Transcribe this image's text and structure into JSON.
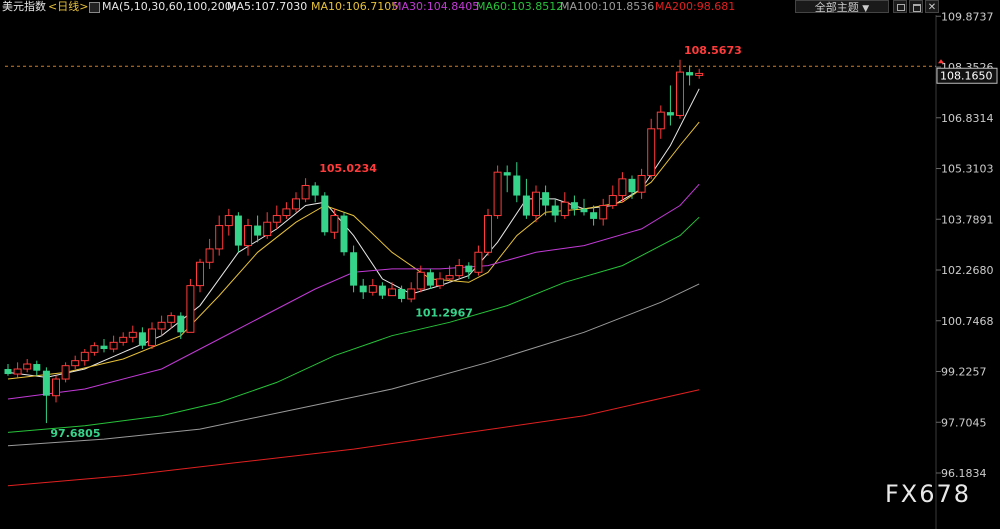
{
  "header": {
    "symbol": "美元指数",
    "period": "<日线>",
    "ma_label": "MA(5,10,30,60,100,200)",
    "ma5": "MA5:107.7030",
    "ma10": "MA10:106.7105",
    "ma30": "MA30:104.8405",
    "ma60": "MA60:103.8512",
    "ma100": "MA100:101.8536",
    "ma200": "MA200:98.681",
    "theme_label": "全部主题",
    "theme_arrow": "▼"
  },
  "watermark": "FX678",
  "colors": {
    "background": "#000000",
    "up": "#ff3b3b",
    "down": "#36d48a",
    "ma5": "#e8e8e8",
    "ma10": "#e6c13a",
    "ma30": "#c23ad6",
    "ma60": "#27c23a",
    "ma100": "#9a9a9a",
    "ma200": "#e02020",
    "axis_text": "#cccccc",
    "price_line": "#d07c2a"
  },
  "chart_data": {
    "type": "candlestick",
    "title": "美元指数",
    "period": "日线",
    "y_ticks": [
      109.8737,
      108.3526,
      106.8314,
      105.3103,
      103.7891,
      102.268,
      100.7468,
      99.2257,
      97.7045,
      96.1834
    ],
    "ylim": [
      95.8,
      110.3
    ],
    "current_price": "108.1650",
    "annotations": [
      {
        "label": "108.5673",
        "value": 108.5673,
        "bar": 70,
        "color": "#ff3b3b"
      },
      {
        "label": "105.0234",
        "value": 105.0234,
        "bar": 32,
        "color": "#ff3b3b"
      },
      {
        "label": "101.2967",
        "value": 101.2967,
        "bar": 42,
        "color": "#36d48a"
      },
      {
        "label": "97.6805",
        "value": 97.6805,
        "bar": 4,
        "color": "#36d48a"
      }
    ],
    "candles": [
      [
        99.3,
        99.15,
        99.45,
        99.1
      ],
      [
        99.15,
        99.3,
        99.5,
        99.05
      ],
      [
        99.3,
        99.45,
        99.6,
        99.2
      ],
      [
        99.45,
        99.25,
        99.55,
        99.1
      ],
      [
        99.25,
        98.5,
        99.35,
        97.68
      ],
      [
        98.5,
        99.0,
        99.1,
        98.3
      ],
      [
        99.0,
        99.4,
        99.5,
        98.9
      ],
      [
        99.4,
        99.55,
        99.7,
        99.3
      ],
      [
        99.55,
        99.8,
        99.9,
        99.4
      ],
      [
        99.8,
        100.0,
        100.1,
        99.7
      ],
      [
        100.0,
        99.9,
        100.2,
        99.8
      ],
      [
        99.9,
        100.1,
        100.3,
        99.8
      ],
      [
        100.1,
        100.25,
        100.4,
        100.0
      ],
      [
        100.25,
        100.4,
        100.6,
        100.1
      ],
      [
        100.4,
        100.0,
        100.55,
        99.9
      ],
      [
        100.0,
        100.5,
        100.7,
        99.9
      ],
      [
        100.5,
        100.7,
        100.9,
        100.3
      ],
      [
        100.7,
        100.9,
        101.0,
        100.5
      ],
      [
        100.9,
        100.4,
        101.0,
        100.2
      ],
      [
        100.4,
        101.8,
        102.0,
        100.4
      ],
      [
        101.8,
        102.5,
        102.6,
        101.6
      ],
      [
        102.5,
        102.9,
        103.2,
        102.3
      ],
      [
        102.9,
        103.6,
        103.9,
        102.7
      ],
      [
        103.6,
        103.9,
        104.1,
        103.3
      ],
      [
        103.9,
        103.0,
        104.0,
        102.8
      ],
      [
        103.0,
        103.6,
        103.8,
        102.7
      ],
      [
        103.6,
        103.3,
        103.9,
        103.1
      ],
      [
        103.3,
        103.7,
        104.0,
        103.2
      ],
      [
        103.7,
        103.9,
        104.2,
        103.5
      ],
      [
        103.9,
        104.1,
        104.3,
        103.8
      ],
      [
        104.1,
        104.4,
        104.6,
        104.0
      ],
      [
        104.4,
        104.8,
        105.02,
        104.3
      ],
      [
        104.8,
        104.5,
        104.9,
        104.3
      ],
      [
        104.5,
        103.4,
        104.6,
        103.3
      ],
      [
        103.4,
        103.9,
        104.1,
        103.2
      ],
      [
        103.9,
        102.8,
        104.0,
        102.7
      ],
      [
        102.8,
        101.8,
        103.0,
        101.6
      ],
      [
        101.8,
        101.6,
        102.0,
        101.4
      ],
      [
        101.6,
        101.8,
        102.0,
        101.5
      ],
      [
        101.8,
        101.5,
        101.9,
        101.4
      ],
      [
        101.5,
        101.7,
        101.9,
        101.5
      ],
      [
        101.7,
        101.4,
        101.8,
        101.3
      ],
      [
        101.4,
        101.7,
        101.9,
        101.3
      ],
      [
        101.7,
        102.2,
        102.4,
        101.6
      ],
      [
        102.2,
        101.8,
        102.3,
        101.7
      ],
      [
        101.8,
        102.0,
        102.2,
        101.7
      ],
      [
        102.0,
        102.1,
        102.4,
        101.9
      ],
      [
        102.1,
        102.4,
        102.6,
        102.0
      ],
      [
        102.4,
        102.2,
        102.5,
        102.0
      ],
      [
        102.2,
        102.8,
        103.0,
        102.1
      ],
      [
        102.8,
        103.9,
        104.1,
        102.7
      ],
      [
        103.9,
        105.2,
        105.4,
        103.8
      ],
      [
        105.2,
        105.1,
        105.4,
        104.6
      ],
      [
        105.1,
        104.5,
        105.5,
        104.3
      ],
      [
        104.5,
        103.9,
        105.0,
        103.8
      ],
      [
        103.9,
        104.6,
        104.8,
        103.7
      ],
      [
        104.6,
        104.2,
        104.8,
        103.9
      ],
      [
        104.2,
        103.9,
        104.4,
        103.7
      ],
      [
        103.9,
        104.3,
        104.6,
        103.8
      ],
      [
        104.3,
        104.1,
        104.5,
        103.9
      ],
      [
        104.1,
        104.0,
        104.4,
        103.9
      ],
      [
        104.0,
        103.8,
        104.2,
        103.6
      ],
      [
        103.8,
        104.2,
        104.4,
        103.6
      ],
      [
        104.2,
        104.5,
        104.8,
        104.1
      ],
      [
        104.5,
        105.0,
        105.2,
        104.3
      ],
      [
        105.0,
        104.6,
        105.1,
        104.4
      ],
      [
        104.6,
        105.1,
        105.3,
        104.4
      ],
      [
        105.1,
        106.5,
        106.8,
        105.0
      ],
      [
        106.5,
        107.0,
        107.2,
        106.2
      ],
      [
        107.0,
        106.9,
        107.8,
        106.6
      ],
      [
        106.9,
        108.2,
        108.57,
        106.8
      ],
      [
        108.2,
        108.1,
        108.4,
        107.8
      ],
      [
        108.1,
        108.16,
        108.3,
        108.0
      ]
    ],
    "ma_series": [
      {
        "name": "MA5",
        "values": [
          [
            0,
            99.2
          ],
          [
            4,
            99.05
          ],
          [
            8,
            99.3
          ],
          [
            12,
            99.8
          ],
          [
            16,
            100.3
          ],
          [
            20,
            101.2
          ],
          [
            24,
            102.8
          ],
          [
            28,
            103.5
          ],
          [
            31,
            104.2
          ],
          [
            33,
            104.3
          ],
          [
            36,
            103.3
          ],
          [
            39,
            102.0
          ],
          [
            42,
            101.55
          ],
          [
            45,
            101.8
          ],
          [
            48,
            102.1
          ],
          [
            51,
            103.1
          ],
          [
            54,
            104.4
          ],
          [
            57,
            104.4
          ],
          [
            60,
            104.1
          ],
          [
            63,
            104.2
          ],
          [
            66,
            104.7
          ],
          [
            69,
            106.0
          ],
          [
            72,
            107.7
          ]
        ]
      },
      {
        "name": "MA10",
        "values": [
          [
            0,
            99.0
          ],
          [
            6,
            99.2
          ],
          [
            12,
            99.6
          ],
          [
            18,
            100.3
          ],
          [
            22,
            101.5
          ],
          [
            26,
            102.8
          ],
          [
            30,
            103.7
          ],
          [
            33,
            104.2
          ],
          [
            36,
            103.9
          ],
          [
            40,
            102.8
          ],
          [
            44,
            102.0
          ],
          [
            48,
            101.9
          ],
          [
            50,
            102.2
          ],
          [
            53,
            103.3
          ],
          [
            56,
            104.0
          ],
          [
            60,
            104.1
          ],
          [
            64,
            104.3
          ],
          [
            67,
            104.9
          ],
          [
            70,
            106.0
          ],
          [
            72,
            106.7
          ]
        ]
      },
      {
        "name": "MA30",
        "values": [
          [
            0,
            98.4
          ],
          [
            8,
            98.7
          ],
          [
            16,
            99.3
          ],
          [
            22,
            100.2
          ],
          [
            28,
            101.1
          ],
          [
            32,
            101.7
          ],
          [
            36,
            102.2
          ],
          [
            40,
            102.3
          ],
          [
            45,
            102.3
          ],
          [
            50,
            102.4
          ],
          [
            55,
            102.8
          ],
          [
            60,
            103.0
          ],
          [
            66,
            103.5
          ],
          [
            70,
            104.2
          ],
          [
            72,
            104.84
          ]
        ]
      },
      {
        "name": "MA60",
        "values": [
          [
            0,
            97.4
          ],
          [
            8,
            97.6
          ],
          [
            16,
            97.9
          ],
          [
            22,
            98.3
          ],
          [
            28,
            98.9
          ],
          [
            34,
            99.7
          ],
          [
            40,
            100.3
          ],
          [
            46,
            100.7
          ],
          [
            52,
            101.2
          ],
          [
            58,
            101.9
          ],
          [
            64,
            102.4
          ],
          [
            70,
            103.3
          ],
          [
            72,
            103.85
          ]
        ]
      },
      {
        "name": "MA100",
        "values": [
          [
            0,
            97.0
          ],
          [
            10,
            97.2
          ],
          [
            20,
            97.5
          ],
          [
            30,
            98.1
          ],
          [
            40,
            98.7
          ],
          [
            50,
            99.5
          ],
          [
            60,
            100.4
          ],
          [
            68,
            101.3
          ],
          [
            72,
            101.85
          ]
        ]
      },
      {
        "name": "MA200",
        "values": [
          [
            0,
            95.8
          ],
          [
            12,
            96.1
          ],
          [
            24,
            96.5
          ],
          [
            36,
            96.9
          ],
          [
            48,
            97.4
          ],
          [
            60,
            97.9
          ],
          [
            72,
            98.68
          ]
        ]
      }
    ]
  }
}
